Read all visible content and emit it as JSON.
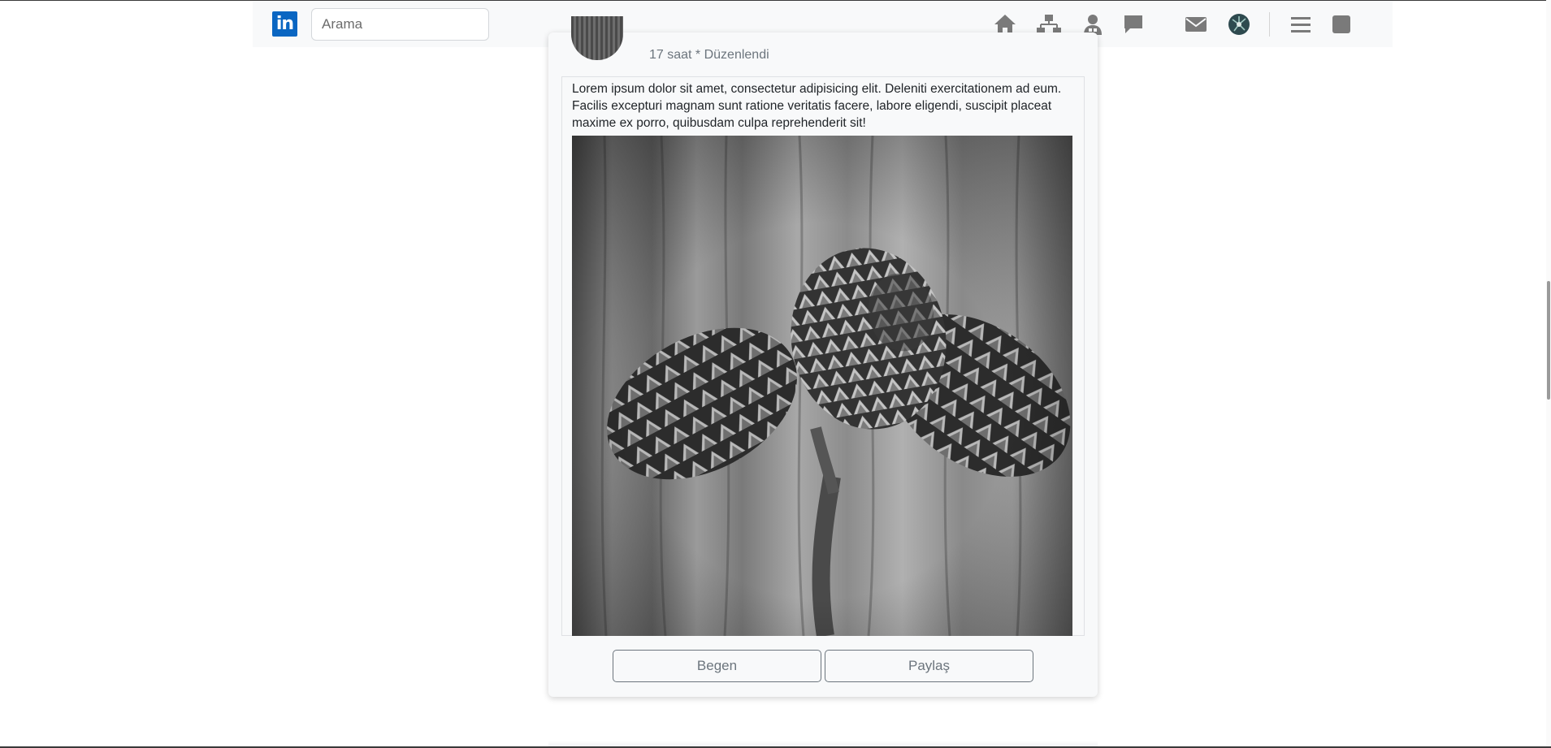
{
  "navbar": {
    "logo_text": "in",
    "search_placeholder": "Arama",
    "icons": [
      "home-icon",
      "network-icon",
      "jobs-icon",
      "messaging-icon",
      "mail-icon",
      "profile-avatar",
      "menu-icon",
      "work-square-icon"
    ]
  },
  "post": {
    "meta": "17 saat * Düzenlendi",
    "text": "Lorem ipsum dolor sit amet, consectetur adipisicing elit. Deleniti exercitationem ad eum. Facilis excepturi magnam sunt ratione veritatis facere, labore eligendi, suscipit placeat maxime ex porro, quibusdam culpa reprehenderit sit!",
    "like_label": "Begen",
    "share_label": "Paylaş"
  },
  "colors": {
    "brand": "#0a66c2",
    "icon_gray": "#7a7a7a"
  }
}
